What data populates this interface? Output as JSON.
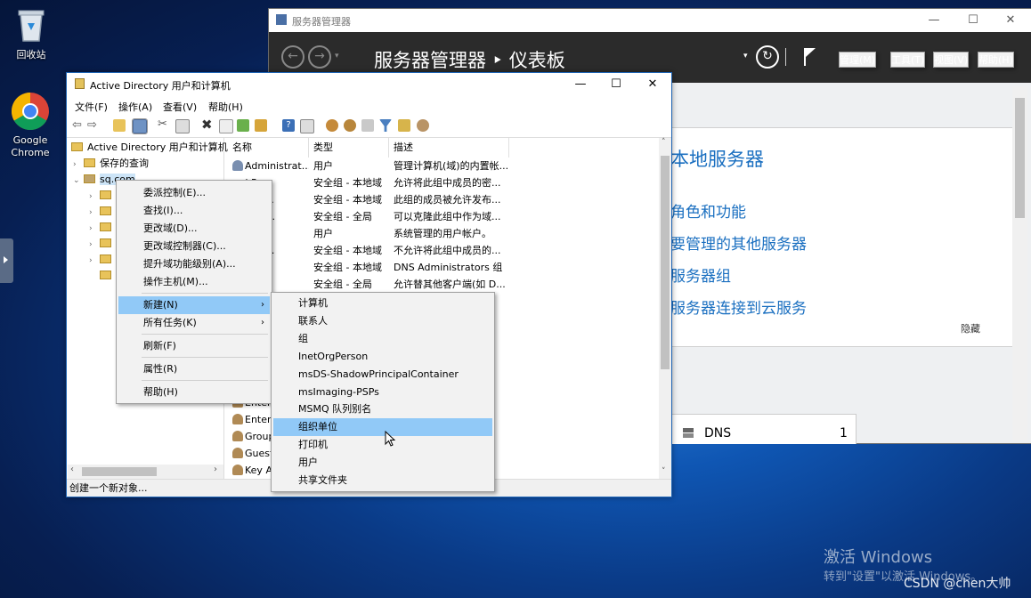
{
  "desktop": {
    "recycle_bin": "回收站",
    "chrome_line1": "Google",
    "chrome_line2": "Chrome",
    "activate_title": "激活 Windows",
    "activate_sub": "转到\"设置\"以激活 Windows。",
    "csdn": "CSDN @chen大帅"
  },
  "server_manager": {
    "title": "服务器管理器",
    "breadcrumb": "服务器管理器 ‣ 仪表板",
    "menu": [
      "管理(M)",
      "工具(T)",
      "视图(V)",
      "帮助(H)"
    ],
    "heading": "本地服务器",
    "links": [
      "角色和功能",
      "要管理的其他服务器",
      "服务器组",
      "服务器连接到云服务"
    ],
    "hide": "隐藏",
    "dns_label": "DNS",
    "dns_count": "1"
  },
  "ad": {
    "title": "Active Directory 用户和计算机",
    "menu": [
      "文件(F)",
      "操作(A)",
      "查看(V)",
      "帮助(H)"
    ],
    "tree": {
      "root": "Active Directory 用户和计算机",
      "saved_queries": "保存的查询",
      "domain": "sq.com"
    },
    "columns": [
      "名称",
      "类型",
      "描述"
    ],
    "rows": [
      {
        "name": "Administrat...",
        "type": "用户",
        "desc": "管理计算机(域)的内置帐..."
      },
      {
        "name": "...d Re...",
        "type": "安全组 - 本地域",
        "desc": "允许将此组中成员的密..."
      },
      {
        "name": "...ublis...",
        "type": "安全组 - 本地域",
        "desc": "此组的成员被允许发布..."
      },
      {
        "name": "...able ...",
        "type": "安全组 - 全局",
        "desc": "可以克隆此组中作为域..."
      },
      {
        "name": "...tAcc...",
        "type": "用户",
        "desc": "系统管理的用户帐户。"
      },
      {
        "name": "...d RO...",
        "type": "安全组 - 本地域",
        "desc": "不允许将此组中成员的..."
      },
      {
        "name": "...mins",
        "type": "安全组 - 本地域",
        "desc": "DNS Administrators 组"
      },
      {
        "name": "...date...",
        "type": "安全组 - 全局",
        "desc": "允许替其他客户端(如 D..."
      }
    ],
    "rows_lower": [
      "Enter",
      "Enter",
      "Group",
      "Guest",
      "Key A"
    ],
    "status": "创建一个新对象..."
  },
  "context_menu": {
    "items": [
      "委派控制(E)...",
      "查找(I)...",
      "更改域(D)...",
      "更改域控制器(C)...",
      "提升域功能级别(A)...",
      "操作主机(M)...",
      "新建(N)",
      "所有任务(K)",
      "刷新(F)",
      "属性(R)",
      "帮助(H)"
    ],
    "highlighted": "新建(N)"
  },
  "submenu": {
    "items": [
      "计算机",
      "联系人",
      "组",
      "InetOrgPerson",
      "msDS-ShadowPrincipalContainer",
      "msImaging-PSPs",
      "MSMQ 队列别名",
      "组织单位",
      "打印机",
      "用户",
      "共享文件夹"
    ],
    "highlighted": "组织单位"
  },
  "colors": {
    "highlight": "#91c9f7",
    "sm_header": "#2b2b2b",
    "sm_link": "#1a6fc0"
  }
}
